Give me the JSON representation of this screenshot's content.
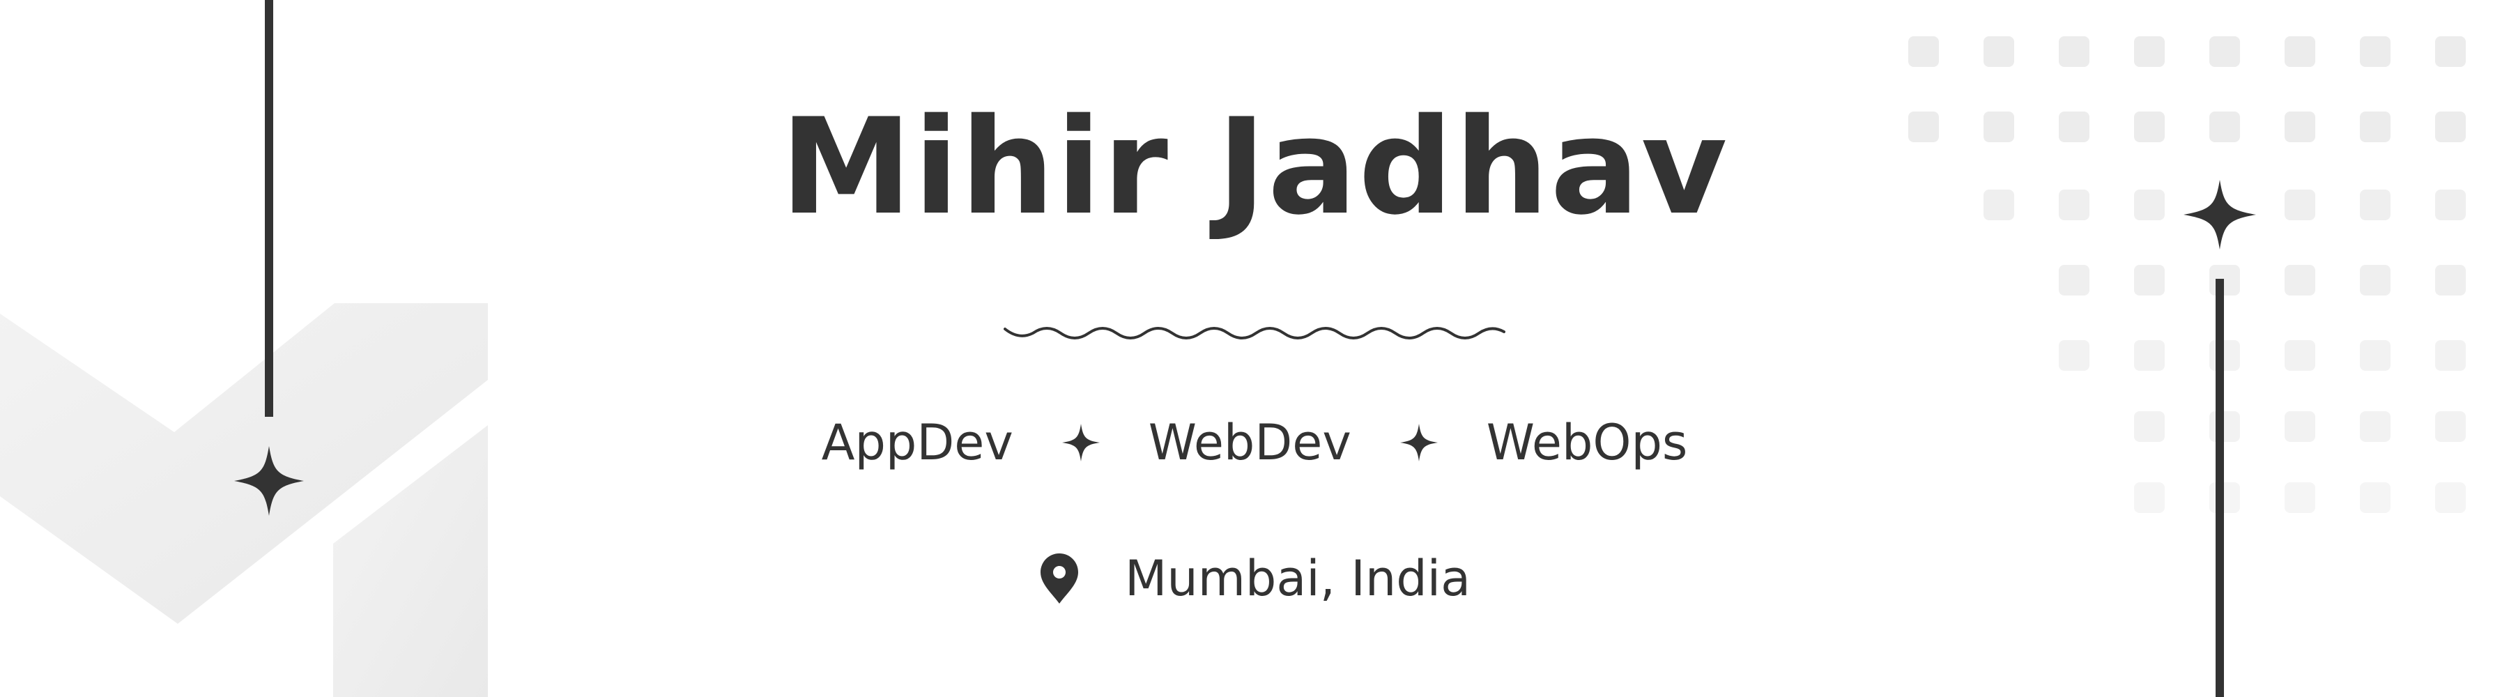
{
  "profile": {
    "name": "Mihir Jadhav",
    "tags": [
      "AppDev",
      "WebDev",
      "WebOps"
    ],
    "location": "Mumbai, India"
  },
  "icons": {
    "separator": "sparkle-icon",
    "location": "map-pin-icon",
    "decoration": "sparkle-icon"
  },
  "colors": {
    "text": "#333333",
    "background": "#ffffff",
    "decor_light": "#efefef"
  }
}
